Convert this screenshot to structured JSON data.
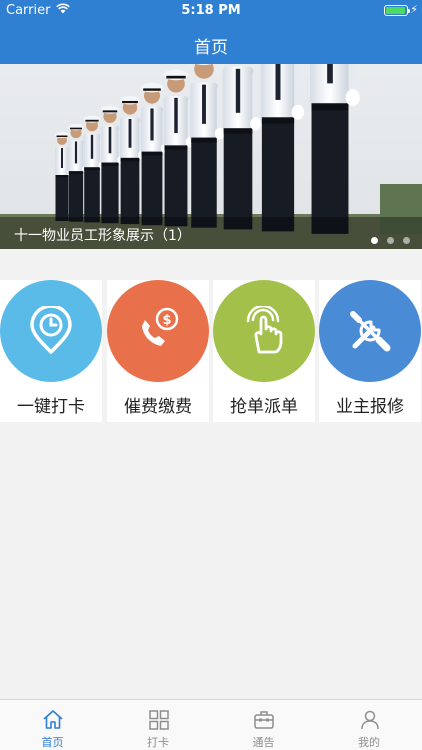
{
  "status_bar": {
    "carrier": "Carrier",
    "time": "5:18 PM",
    "battery_level": 0.95
  },
  "nav": {
    "title": "首页"
  },
  "banner": {
    "caption": "十一物业员工形象展示（1）",
    "page_count": 3,
    "active_index": 0
  },
  "functions": [
    {
      "label": "一键打卡",
      "icon": "clock-pin-icon",
      "color": "#5bbbe8"
    },
    {
      "label": "催费缴费",
      "icon": "phone-money-icon",
      "color": "#e8704a"
    },
    {
      "label": "抢单派单",
      "icon": "tap-hand-icon",
      "color": "#a3c04a"
    },
    {
      "label": "业主报修",
      "icon": "wrench-screwdriver-icon",
      "color": "#4a8bd6"
    }
  ],
  "tabs": [
    {
      "label": "首页",
      "icon": "home-icon",
      "active": true
    },
    {
      "label": "打卡",
      "icon": "grid-icon",
      "active": false
    },
    {
      "label": "通告",
      "icon": "briefcase-icon",
      "active": false
    },
    {
      "label": "我的",
      "icon": "person-icon",
      "active": false
    }
  ],
  "colors": {
    "primary": "#2f7fd3",
    "tab_inactive": "#8e8e8e",
    "background": "#f2f2f2"
  }
}
